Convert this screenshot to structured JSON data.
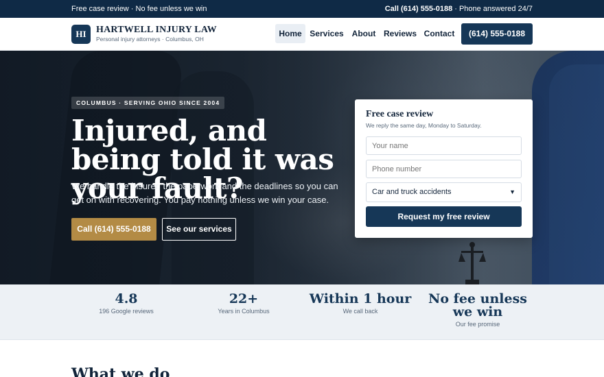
{
  "topbar": {
    "left_text": "Free case review · No fee unless we win",
    "right_call": "Call (614) 555-0188",
    "right_suffix": " · Phone answered 24/7"
  },
  "header": {
    "logo_initials": "HI",
    "brand_name": "HARTWELL INJURY LAW",
    "brand_tagline": "Personal injury attorneys · Columbus, OH",
    "nav": [
      {
        "label": "Home",
        "active": true
      },
      {
        "label": "Services",
        "active": false
      },
      {
        "label": "About",
        "active": false
      },
      {
        "label": "Reviews",
        "active": false
      },
      {
        "label": "Contact",
        "active": false
      }
    ],
    "cta_label": "(614) 555-0188"
  },
  "hero": {
    "badge": "COLUMBUS · SERVING OHIO SINCE 2004",
    "headline": "Injured, and being told it was your fault?",
    "subcopy": "We handle the insurer, the paperwork and the deadlines so you can get on with recovering. You pay nothing unless we win your case.",
    "primary_button": "Call (614) 555-0188",
    "secondary_button": "See our services",
    "scale_icon": "scales-of-justice-icon"
  },
  "form": {
    "title": "Free case review",
    "subtitle": "We reply the same day, Monday to Saturday.",
    "name_placeholder": "Your name",
    "phone_placeholder": "Phone number",
    "case_type_selected": "Car and truck accidents",
    "submit_label": "Request my free review"
  },
  "stats": [
    {
      "value": "4.8",
      "label": "196 Google reviews"
    },
    {
      "value": "22+",
      "label": "Years in Columbus"
    },
    {
      "value": "Within 1 hour",
      "label": "We call back"
    },
    {
      "value": "No fee unless we win",
      "label": "Our fee promise"
    }
  ],
  "services_heading": "What we do",
  "colors": {
    "navy": "#163757",
    "topbar": "#0f2a46",
    "gold": "#b38b45",
    "stats_bg": "#edf1f5"
  }
}
